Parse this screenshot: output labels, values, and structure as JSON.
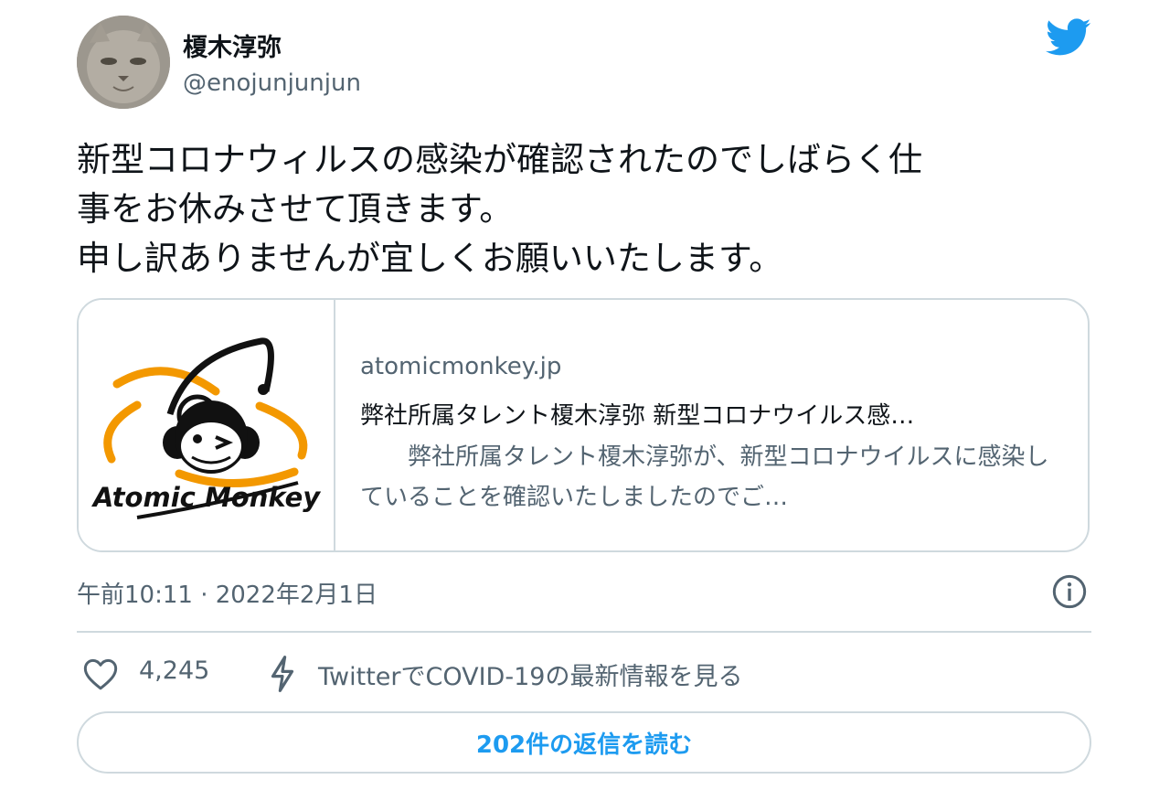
{
  "author": {
    "display_name": "榎木淳弥",
    "handle": "@enojunjunjun"
  },
  "tweet": {
    "text": "新型コロナウィルスの感染が確認されたのでしばらく仕\n事をお休みさせて頂きます。\n申し訳ありませんが宜しくお願いいたします。"
  },
  "card": {
    "logo_text": "Atomic Monkey",
    "domain": "atomicmonkey.jp",
    "title": "弊社所属タレント榎木淳弥 新型コロナウイルス感…",
    "description": "　　弊社所属タレント榎木淳弥が、新型コロナウイルスに感染していることを確認いたしましたのでご…"
  },
  "meta": {
    "timestamp": "午前10:11 · 2022年2月1日"
  },
  "actions": {
    "like_count": "4,245",
    "covid_link": "TwitterでCOVID-19の最新情報を見る"
  },
  "replies_button": {
    "label": "202件の返信を読む"
  },
  "colors": {
    "twitter_blue": "#1d9bf0",
    "text_primary": "#0f1419",
    "text_secondary": "#536471",
    "border": "#cfd9de",
    "logo_orange": "#f39800"
  },
  "icons": [
    "twitter-bird-icon",
    "info-icon",
    "heart-icon",
    "lightning-icon"
  ]
}
